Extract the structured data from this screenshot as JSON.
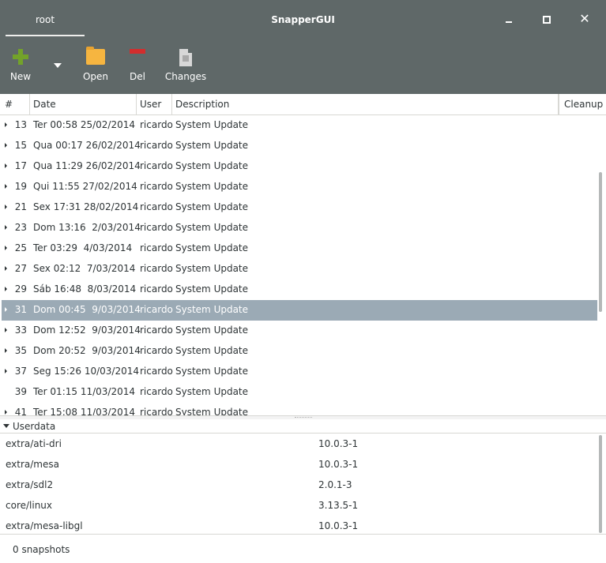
{
  "window": {
    "tab_label": "root",
    "title": "SnapperGUI",
    "close_glyph": "✕"
  },
  "toolbar": {
    "new_label": "New",
    "open_label": "Open",
    "del_label": "Del",
    "changes_label": "Changes"
  },
  "table": {
    "headers": {
      "num": "#",
      "date": "Date",
      "user": "User",
      "description": "Description",
      "cleanup": "Cleanup"
    },
    "rows": [
      {
        "num": "13",
        "date": "Ter 00:58 25/02/2014",
        "user": "ricardo",
        "description": "System Update"
      },
      {
        "num": "15",
        "date": "Qua 00:17 26/02/2014",
        "user": "ricardo",
        "description": "System Update"
      },
      {
        "num": "17",
        "date": "Qua 11:29 26/02/2014",
        "user": "ricardo",
        "description": "System Update"
      },
      {
        "num": "19",
        "date": "Qui 11:55 27/02/2014",
        "user": "ricardo",
        "description": "System Update"
      },
      {
        "num": "21",
        "date": "Sex 17:31 28/02/2014",
        "user": "ricardo",
        "description": "System Update"
      },
      {
        "num": "23",
        "date": "Dom 13:16  2/03/2014",
        "user": "ricardo",
        "description": "System Update"
      },
      {
        "num": "25",
        "date": "Ter 03:29  4/03/2014",
        "user": "ricardo",
        "description": "System Update"
      },
      {
        "num": "27",
        "date": "Sex 02:12  7/03/2014",
        "user": "ricardo",
        "description": "System Update"
      },
      {
        "num": "29",
        "date": "Sáb 16:48  8/03/2014",
        "user": "ricardo",
        "description": "System Update"
      },
      {
        "num": "31",
        "date": "Dom 00:45  9/03/2014",
        "user": "ricardo",
        "description": "System Update",
        "selected": true
      },
      {
        "num": "33",
        "date": "Dom 12:52  9/03/2014",
        "user": "ricardo",
        "description": "System Update"
      },
      {
        "num": "35",
        "date": "Dom 20:52  9/03/2014",
        "user": "ricardo",
        "description": "System Update"
      },
      {
        "num": "37",
        "date": "Seg 15:26 10/03/2014",
        "user": "ricardo",
        "description": "System Update"
      },
      {
        "num": "39",
        "date": "Ter 01:15 11/03/2014",
        "user": "ricardo",
        "description": "System Update",
        "no_expander": true
      },
      {
        "num": "41",
        "date": "Ter 15:08 11/03/2014",
        "user": "ricardo",
        "description": "System Update"
      }
    ]
  },
  "userdata": {
    "label": "Userdata",
    "packages": [
      {
        "name": "extra/ati-dri",
        "version": "10.0.3-1"
      },
      {
        "name": "extra/mesa",
        "version": "10.0.3-1"
      },
      {
        "name": "extra/sdl2",
        "version": "2.0.1-3"
      },
      {
        "name": "core/linux",
        "version": "3.13.5-1"
      },
      {
        "name": "extra/mesa-libgl",
        "version": "10.0.3-1"
      }
    ]
  },
  "status": {
    "text": "0 snapshots"
  },
  "colors": {
    "header_bg": "#5f6868",
    "selection_bg": "#9baab5",
    "new_icon": "#73a22a",
    "del_icon": "#d32d2d",
    "folder_icon": "#f6b540"
  }
}
